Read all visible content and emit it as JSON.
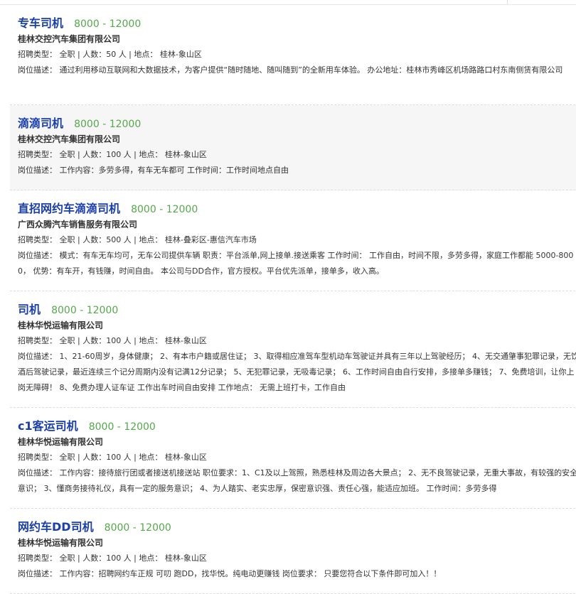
{
  "jobs": [
    {
      "title": "专车司机",
      "salary": "8000 - 12000",
      "company": "桂林交控汽车集团有限公司",
      "info": "招聘类型： 全职 | 人数：50 人 | 地点： 桂林-象山区",
      "description": "岗位描述： 通过利用移动互联网和大数据技术，为客户提供“随时随地、随叫随到”的全新用车体验。 办公地址：桂林市秀峰区机场路路口村东南侧赁有限公司"
    },
    {
      "title": "滴滴司机",
      "salary": "8000 - 12000",
      "company": "桂林交控汽车集团有限公司",
      "info": "招聘类型： 全职 | 人数：100 人 | 地点： 桂林-象山区",
      "description": "岗位描述： 工作内容：多劳多得，有车无车都可 工作时间：工作时间地点自由"
    },
    {
      "title": "直招网约车滴滴司机",
      "salary": "8000 - 12000",
      "company": "广西众腾汽车销售服务有限公司",
      "info": "招聘类型： 全职 | 人数：500 人 | 地点： 桂林-叠彩区-惠信汽车市场",
      "description": "岗位描述： 模式：有车无车均可，无车公司提供车辆 职责：平台派单,网上接单.接送乘客 工作时间： 工作自由，时间不限，多劳多得，家庭工作都能 5000-8000， 优势：有车开，有钱赚，时间自由。 本公司与DD合作，官方授权。平台优先派单，接单多，收入高。"
    },
    {
      "title": "司机",
      "salary": "8000 - 12000",
      "company": "桂林华悦运输有限公司",
      "info": "招聘类型： 全职 | 人数：100 人 | 地点： 桂林-象山区",
      "description": "岗位描述： 1、21-60周岁，身体健康； 2、有本市户籍或居住证； 3、取得相应准驾车型机动车驾驶证并具有三年以上驾驶经历； 4、无交通肇事犯罪记录，无饮酒后驾驶记录，最近连续三个记分周期内没有记满12分记录； 5、无犯罪记录，无吸毒记录； 6、工作时间自由自行安排，多接单多赚钱； 7、免费培训，让你上岗无障碍！ 8、免费办理人证车证 工作出车时间自由安排 工作地点： 无需上班打卡，工作自由"
    },
    {
      "title": "c1客运司机",
      "salary": "8000 - 12000",
      "company": "桂林华悦运输有限公司",
      "info": "招聘类型： 全职 | 人数：100 人 | 地点： 桂林-象山区",
      "description": "岗位描述： 工作内容：接待旅行团或者接送机接送站 职位要求：1、C1及以上驾照，熟悉桂林及周边各大景点； 2、无不良驾驶记录，无重大事故，有较强的安全意识； 3、懂商务接待礼仪，具有一定的服务意识； 4、为人踏实、老实忠厚，保密意识强、责任心强，能适应加班。 工作时间：多劳多得"
    },
    {
      "title": "网约车DD司机",
      "salary": "8000 - 12000",
      "company": "桂林华悦运输有限公司",
      "info": "招聘类型： 全职 | 人数：100 人 | 地点： 桂林-象山区",
      "description": "岗位描述： 工作内容：招聘网约车正规 可叨 跑DD，找华悦。纯电动更赚钱 岗位要求： 只要您符合以下条件即可加入！！"
    }
  ]
}
